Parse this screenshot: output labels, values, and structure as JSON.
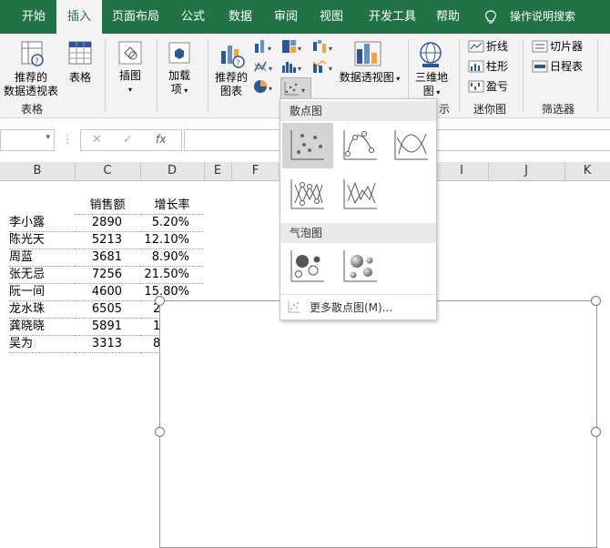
{
  "tabs": [
    {
      "label": "开始"
    },
    {
      "label": "插入"
    },
    {
      "label": "页面布局"
    },
    {
      "label": "公式"
    },
    {
      "label": "数据"
    },
    {
      "label": "审阅"
    },
    {
      "label": "视图"
    },
    {
      "label": "开发工具"
    },
    {
      "label": "帮助"
    },
    {
      "label": "操作说明搜索"
    }
  ],
  "ribbon": {
    "pivot_line1": "推荐的",
    "pivot_line2": "数据透视表",
    "table": "表格",
    "illustrations": "插图",
    "addins_line1": "加载",
    "addins_line2": "项",
    "rec_chart_line1": "推荐的",
    "rec_chart_line2": "图表",
    "pivot_chart": "数据透视图",
    "map3d_line1": "三维地",
    "map3d_line2": "图",
    "spark_line": "折线",
    "spark_column": "柱形",
    "spark_winloss": "盈亏",
    "slicer": "切片器",
    "timeline": "日程表",
    "group_tables": "表格",
    "group_tours": "示",
    "group_sparklines": "迷你图",
    "group_filters": "筛选器"
  },
  "formula_bar": {
    "fx": "fx"
  },
  "columns": [
    "B",
    "C",
    "D",
    "E",
    "F",
    "I",
    "J",
    "K"
  ],
  "sheet": {
    "header_sales": "销售额",
    "header_growth": "增长率",
    "rows": [
      {
        "name": "李小露",
        "sales": "2890",
        "growth": "5.20%"
      },
      {
        "name": "陈光天",
        "sales": "5213",
        "growth": "12.10%"
      },
      {
        "name": "周蓝",
        "sales": "3681",
        "growth": "8.90%"
      },
      {
        "name": "张无忌",
        "sales": "7256",
        "growth": "21.50%"
      },
      {
        "name": "阮一间",
        "sales": "4600",
        "growth": "15.80%"
      },
      {
        "name": "龙水珠",
        "sales": "6505",
        "growth": "2"
      },
      {
        "name": "龚晓晓",
        "sales": "5891",
        "growth": "1"
      },
      {
        "name": "吴为",
        "sales": "3313",
        "growth": "8"
      }
    ]
  },
  "dropdown": {
    "scatter_header": "散点图",
    "bubble_header": "气泡图",
    "more_link": "更多散点图(M)..."
  },
  "colors": {
    "excel_green": "#217346",
    "ribbon_bg": "#f3f3f3"
  }
}
